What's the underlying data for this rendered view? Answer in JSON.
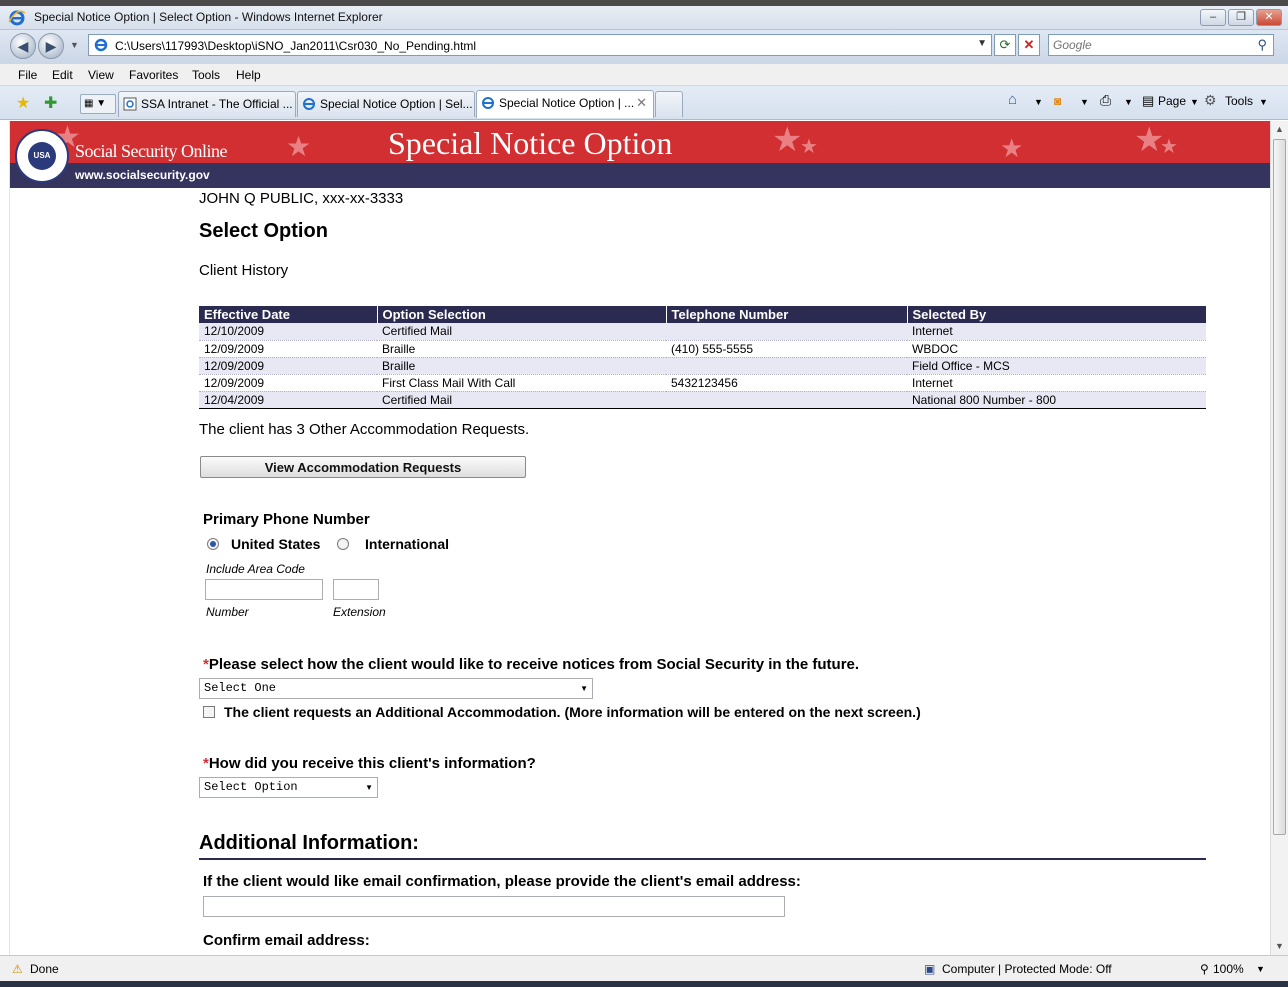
{
  "window": {
    "title": "Special Notice Option | Select Option - Windows Internet Explorer",
    "minimize": "–",
    "restore": "❐",
    "close": "✕"
  },
  "address": {
    "url": "C:\\Users\\117993\\Desktop\\iSNO_Jan2011\\Csr030_No_Pending.html",
    "search_placeholder": "Google"
  },
  "menu": {
    "file": "File",
    "edit": "Edit",
    "view": "View",
    "favorites": "Favorites",
    "tools": "Tools",
    "help": "Help"
  },
  "tabs": [
    {
      "label": "SSA Intranet - The Official ..."
    },
    {
      "label": "Special Notice Option | Sel..."
    },
    {
      "label": "Special Notice Option | ..."
    }
  ],
  "commands": {
    "page": "Page",
    "tools": "Tools"
  },
  "banner": {
    "site_name": "Social Security Online",
    "site_url": "www.socialsecurity.gov",
    "heading": "Special Notice Option",
    "seal_text": "USA"
  },
  "client": {
    "name_line": "JOHN Q PUBLIC, xxx-xx-3333"
  },
  "page": {
    "title": "Select Option",
    "history_label": "Client History",
    "accommodation_text": "The client has 3 Other Accommodation Requests.",
    "view_accommodation_button": "View Accommodation Requests"
  },
  "history_table": {
    "headers": [
      "Effective Date",
      "Option Selection",
      "Telephone Number",
      "Selected By"
    ],
    "rows": [
      [
        "12/10/2009",
        "Certified Mail",
        "",
        "Internet"
      ],
      [
        "12/09/2009",
        "Braille",
        "(410) 555-5555",
        "WBDOC"
      ],
      [
        "12/09/2009",
        "Braille",
        "",
        "Field Office - MCS"
      ],
      [
        "12/09/2009",
        "First Class Mail With Call",
        "5432123456",
        "Internet"
      ],
      [
        "12/04/2009",
        "Certified Mail",
        "",
        "National 800 Number - 800"
      ]
    ]
  },
  "phone": {
    "label": "Primary Phone Number",
    "option_us": "United States",
    "option_intl": "International",
    "selected": "United States",
    "area_code_hint": "Include Area Code",
    "number_label": "Number",
    "extension_label": "Extension",
    "number_value": "",
    "extension_value": ""
  },
  "notice": {
    "required_mark": "*",
    "question": "Please select how the client would like to receive notices from Social Security in the future.",
    "select_value": "Select One",
    "additional_accommodation_label": "The client requests an Additional Accommodation. (More information will be entered on the next screen.)",
    "additional_accommodation_checked": false
  },
  "source": {
    "required_mark": "*",
    "question": "How did you receive this client's information?",
    "select_value": "Select Option"
  },
  "additional_info": {
    "heading": "Additional Information:",
    "email_prompt": "If the client would like email confirmation, please provide the client's email address:",
    "email_value": "",
    "confirm_email_label": "Confirm email address:"
  },
  "status": {
    "left": "Done",
    "zone": "Computer | Protected Mode: Off",
    "zoom": "100%"
  }
}
